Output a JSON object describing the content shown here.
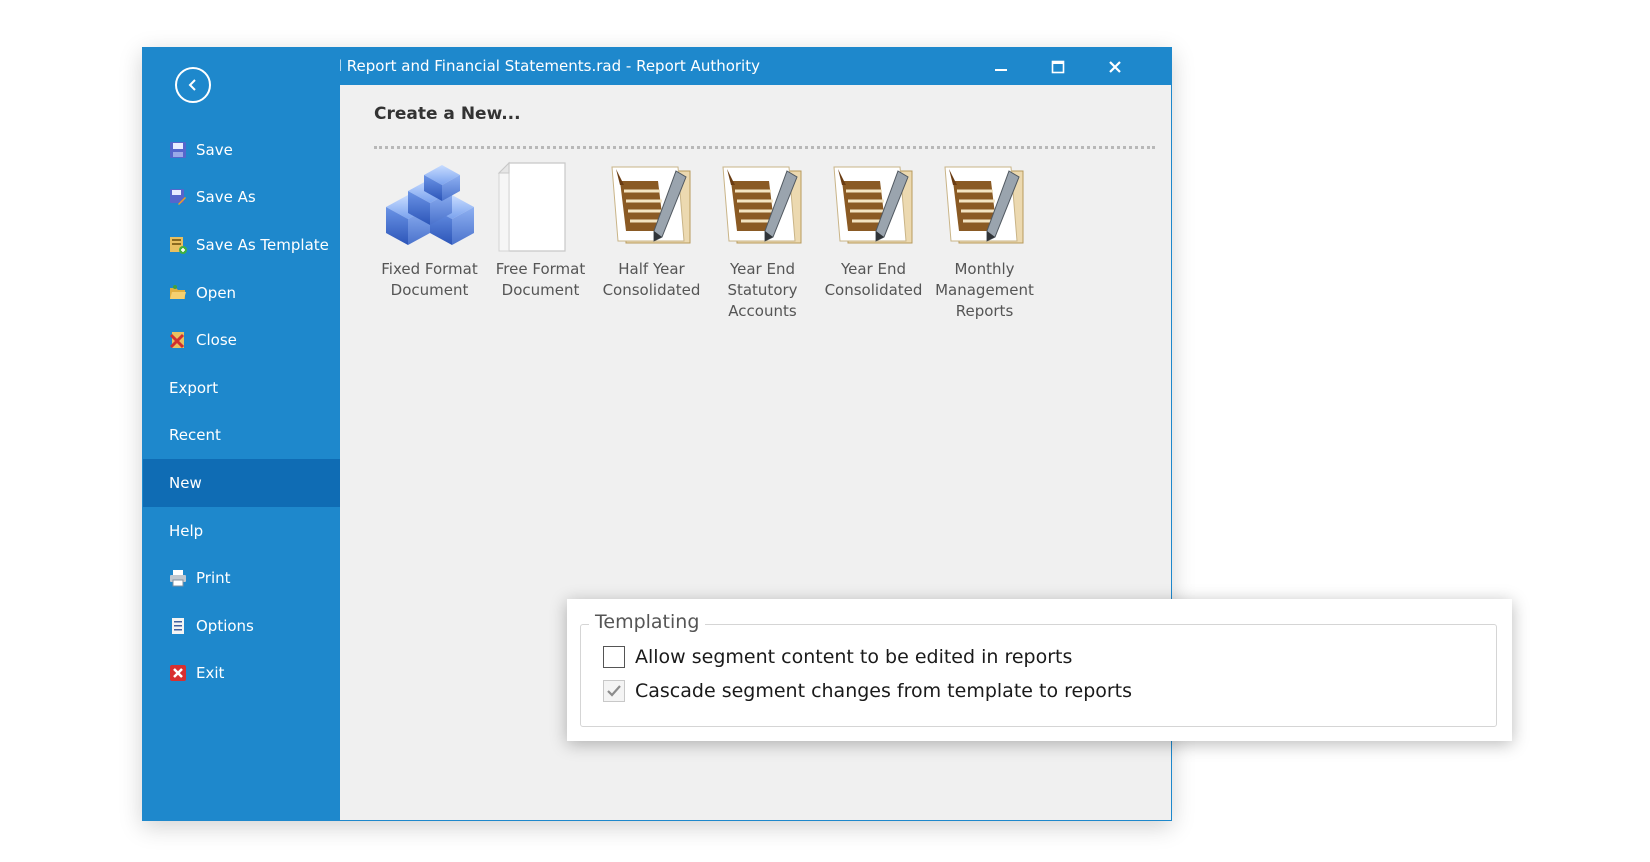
{
  "window": {
    "title": "Annual Report and Financial Statements.rad - Report Authority",
    "title_visible": "ual Report and Financial Statements.rad - Report Authority",
    "accent_color": "#1e88cc",
    "selected_color": "#0f6cb4"
  },
  "sidebar": {
    "back_icon": "back-arrow-circle-icon",
    "items": [
      {
        "label": "Save",
        "icon": "save-icon"
      },
      {
        "label": "Save As",
        "icon": "save-as-icon"
      },
      {
        "label": "Save As Template",
        "icon": "save-as-template-icon"
      },
      {
        "label": "Open",
        "icon": "open-folder-icon"
      },
      {
        "label": "Close",
        "icon": "close-document-icon"
      },
      {
        "label": "Export",
        "icon": ""
      },
      {
        "label": "Recent",
        "icon": ""
      },
      {
        "label": "New",
        "icon": "",
        "selected": true
      },
      {
        "label": "Help",
        "icon": ""
      },
      {
        "label": "Print",
        "icon": "printer-icon"
      },
      {
        "label": "Options",
        "icon": "options-icon"
      },
      {
        "label": "Exit",
        "icon": "exit-icon"
      }
    ]
  },
  "main": {
    "heading": "Create a New...",
    "tiles": [
      {
        "label": "Fixed Format\nDocument",
        "icon": "blue-cubes-icon"
      },
      {
        "label": "Free Format\nDocument",
        "icon": "blank-page-icon"
      },
      {
        "label": "Half Year\nConsolidated",
        "icon": "report-template-icon"
      },
      {
        "label": "Year End\nStatutory\nAccounts",
        "icon": "report-template-icon"
      },
      {
        "label": "Year End\nConsolidated",
        "icon": "report-template-icon"
      },
      {
        "label": "Monthly\nManagement\nReports",
        "icon": "report-template-icon"
      }
    ]
  },
  "templating": {
    "legend": "Templating",
    "options": [
      {
        "label": "Allow segment content to be edited in reports",
        "checked": false
      },
      {
        "label": "Cascade segment changes from template to reports",
        "checked": true
      }
    ]
  }
}
